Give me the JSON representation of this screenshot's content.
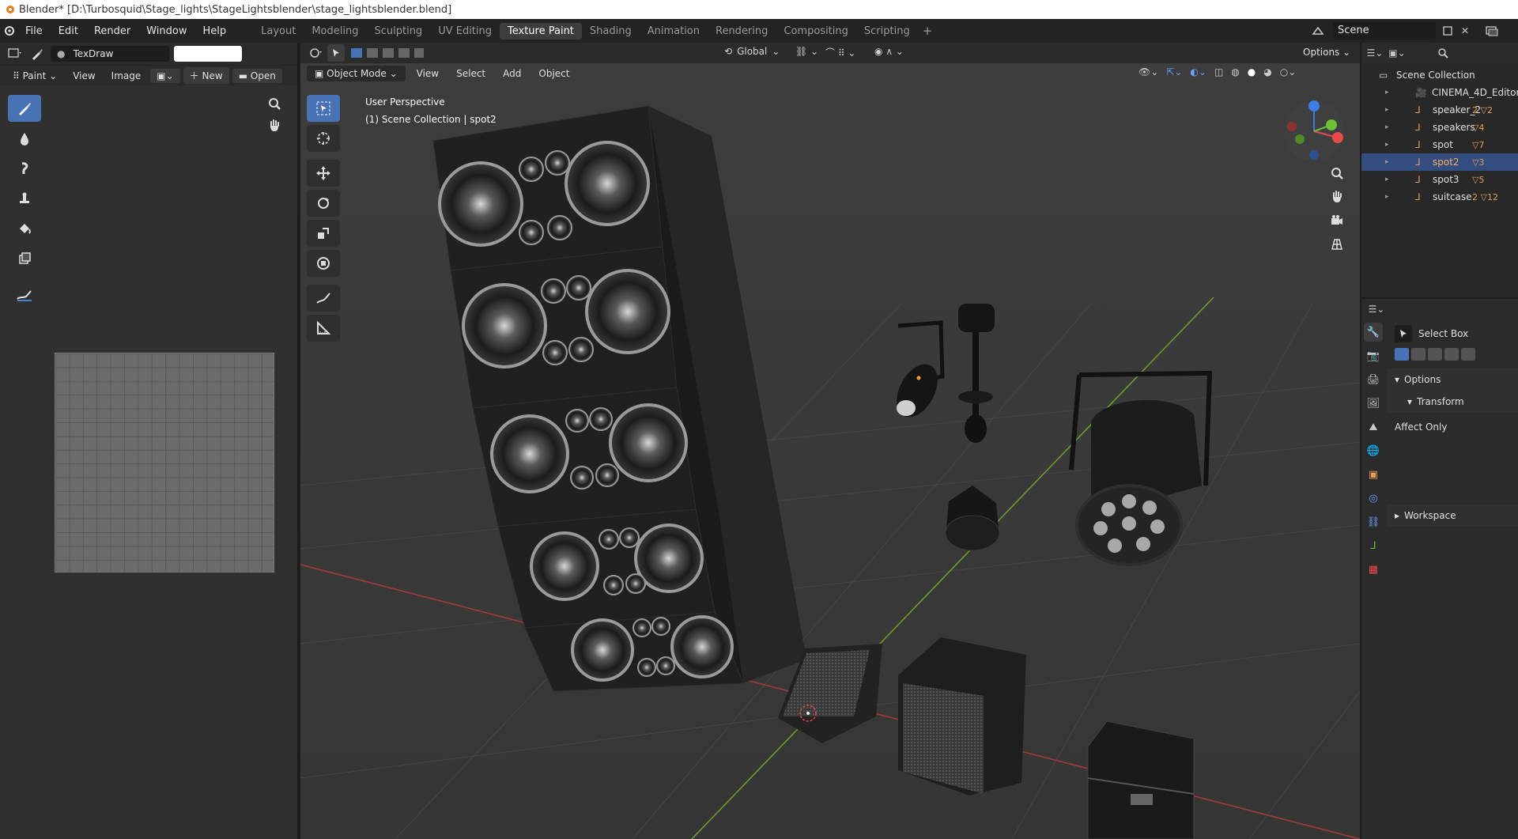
{
  "window": {
    "title": "Blender* [D:\\Turbosquid\\Stage_lights\\StageLightsblender\\stage_lightsblender.blend]"
  },
  "menu": [
    "File",
    "Edit",
    "Render",
    "Window",
    "Help"
  ],
  "workspaces": [
    "Layout",
    "Modeling",
    "Sculpting",
    "UV Editing",
    "Texture Paint",
    "Shading",
    "Animation",
    "Rendering",
    "Compositing",
    "Scripting"
  ],
  "active_workspace": "Texture Paint",
  "scene": {
    "name": "Scene"
  },
  "image_editor": {
    "brush_name": "TexDraw",
    "mode_label": "Paint",
    "menus": [
      "View",
      "Image"
    ],
    "new_label": "New",
    "open_label": "Open",
    "color": "#ffffff"
  },
  "viewport": {
    "mode": "Object Mode",
    "menus": [
      "View",
      "Select",
      "Add",
      "Object"
    ],
    "transform_orientation": "Global",
    "options_label": "Options",
    "perspective_label": "User Perspective",
    "collection_label": "(1) Scene Collection | spot2"
  },
  "outliner": {
    "root": "Scene Collection",
    "items": [
      {
        "name": "CINEMA_4D_Editor",
        "badge": ""
      },
      {
        "name": "speaker_2",
        "badge": "2 ▽2"
      },
      {
        "name": "speakers",
        "badge": "▽4"
      },
      {
        "name": "spot",
        "badge": "▽7"
      },
      {
        "name": "spot2",
        "badge": "▽3"
      },
      {
        "name": "spot3",
        "badge": "▽5"
      },
      {
        "name": "suitcase",
        "badge": "2 ▽12"
      }
    ],
    "selected": "spot2"
  },
  "properties": {
    "tool_name": "Select Box",
    "options_label": "Options",
    "transform_label": "Transform",
    "affect_only_label": "Affect Only",
    "workspace_label": "Workspace"
  },
  "colors": {
    "accent": "#4772b3",
    "selected_row": "#334d80",
    "object_orange": "#e79c54"
  }
}
